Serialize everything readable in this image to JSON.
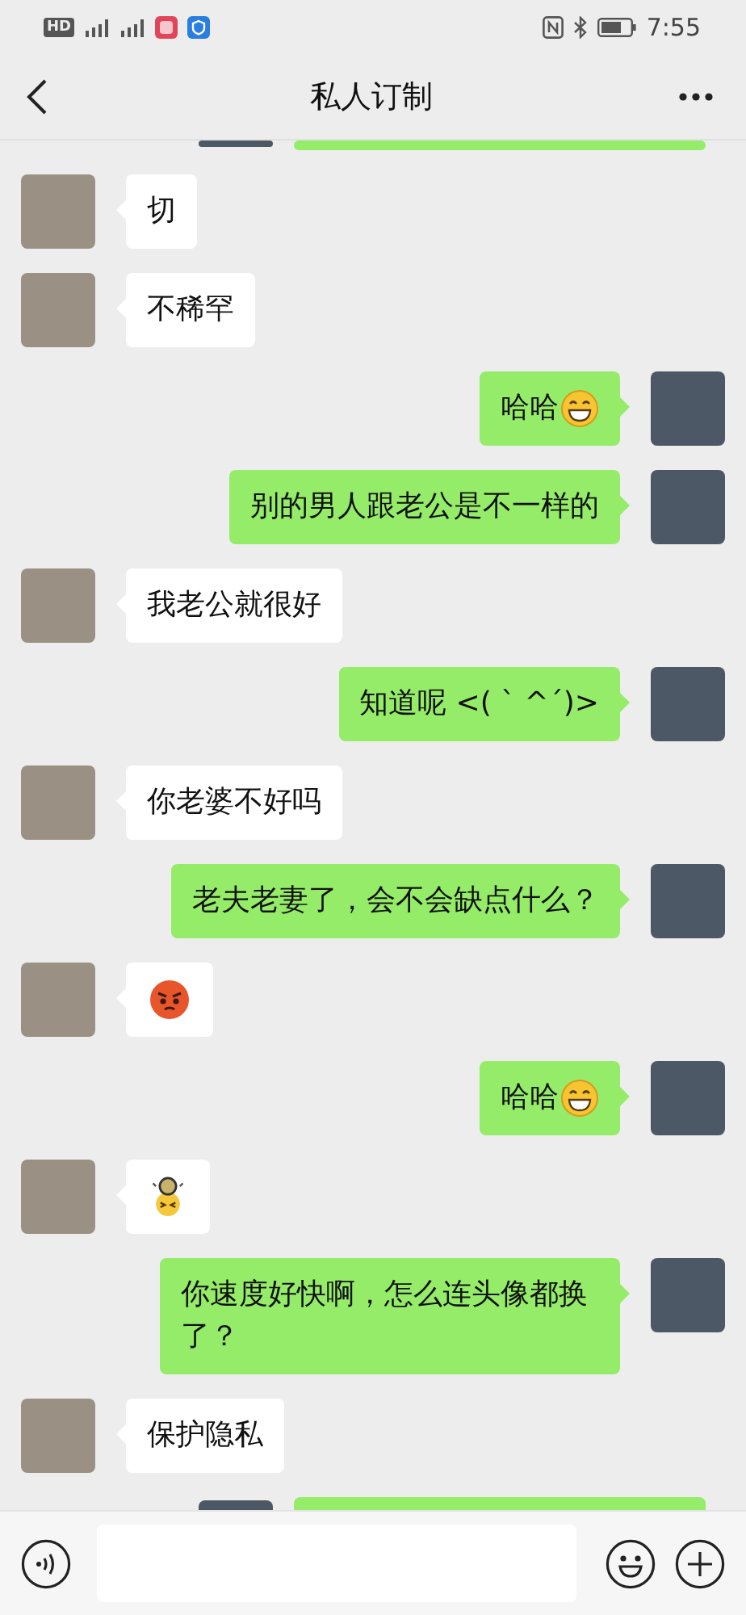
{
  "status_bar": {
    "hd_badge": "HD",
    "time": "7:55"
  },
  "header": {
    "title": "私人订制"
  },
  "messages": [
    {
      "outgoing": true,
      "kind": "clipped"
    },
    {
      "outgoing": false,
      "kind": "text",
      "text": "切"
    },
    {
      "outgoing": false,
      "kind": "text",
      "text": "不稀罕"
    },
    {
      "outgoing": true,
      "kind": "textgrin",
      "text": "哈哈"
    },
    {
      "outgoing": true,
      "kind": "text",
      "text": "别的男人跟老公是不一样的"
    },
    {
      "outgoing": false,
      "kind": "text",
      "text": "我老公就很好"
    },
    {
      "outgoing": true,
      "kind": "text",
      "text": "知道呢 <( ` ^´)>"
    },
    {
      "outgoing": false,
      "kind": "text",
      "text": "你老婆不好吗"
    },
    {
      "outgoing": true,
      "kind": "text",
      "text": "老夫老妻了，会不会缺点什么？"
    },
    {
      "outgoing": false,
      "kind": "angry"
    },
    {
      "outgoing": true,
      "kind": "textgrin",
      "text": "哈哈"
    },
    {
      "outgoing": false,
      "kind": "dizzy"
    },
    {
      "outgoing": true,
      "kind": "text",
      "text": "你速度好快啊，怎么连头像都换了？"
    },
    {
      "outgoing": false,
      "kind": "text",
      "text": "保护隐私"
    },
    {
      "outgoing": true,
      "kind": "clipped"
    }
  ]
}
